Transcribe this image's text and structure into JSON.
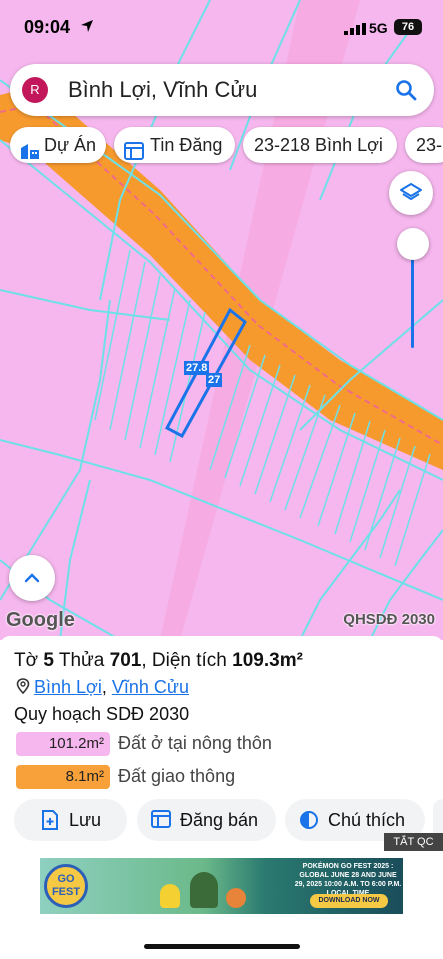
{
  "status_bar": {
    "time": "09:04",
    "network": "5G",
    "battery": "76"
  },
  "search": {
    "avatar_letter": "R",
    "query": "Bình Lợi, Vĩnh Cửu"
  },
  "chips": [
    {
      "label": "Dự Án",
      "icon": "building-icon"
    },
    {
      "label": "Tin Đăng",
      "icon": "listing-icon"
    },
    {
      "label": "23-218 Bình Lợi"
    },
    {
      "label": "23-"
    }
  ],
  "map": {
    "parcel_labels": [
      "27.8",
      "27"
    ],
    "attribution": "Google",
    "plan_badge": "QHSDĐ 2030",
    "colors": {
      "residential": "#f6b7ee",
      "road": "#f8a13a",
      "boundary": "#6de0e8"
    }
  },
  "info": {
    "sheet_prefix": "Tờ",
    "sheet": "5",
    "parcel_prefix": "Thửa",
    "parcel": "701",
    "area_prefix": "Diện tích",
    "area": "109.3m²",
    "location_parts": [
      "Bình Lợi",
      "Vĩnh Cửu"
    ],
    "location_separator": ",",
    "plan_title": "Quy hoạch SDĐ 2030",
    "legend": [
      {
        "value": "101.2m²",
        "label": "Đất ở tại nông thôn",
        "color": "#f6b7ee"
      },
      {
        "value": "8.1m²",
        "label": "Đất giao thông",
        "color": "#f8a13a"
      }
    ]
  },
  "actions": [
    {
      "label": "Lưu",
      "icon": "save-icon"
    },
    {
      "label": "Đăng bán",
      "icon": "post-icon"
    },
    {
      "label": "Chú thích",
      "icon": "legend-icon"
    }
  ],
  "ad": {
    "close_label": "TẮT QC",
    "logo_text": "GO FEST",
    "headline": "POKÉMON GO FEST 2025 : GLOBAL JUNE 28 AND JUNE 29, 2025 10:00 A.M. TO 6:00 P.M. LOCAL TIME",
    "cta": "DOWNLOAD NOW"
  }
}
